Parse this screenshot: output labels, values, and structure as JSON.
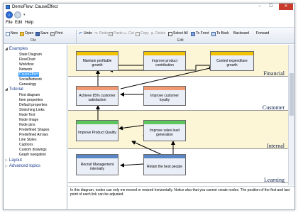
{
  "window": {
    "title": "DemoFlow: CauseEffect",
    "controls": {
      "minimize": "–",
      "maximize": "☐",
      "close": "✕"
    }
  },
  "menu": {
    "file": "File",
    "edit": "Edit",
    "help": "Help"
  },
  "toolbar": {
    "new": "New",
    "open": "Open",
    "save": "Save",
    "print": "Print",
    "undo": "Undo",
    "redo": "Redo",
    "copy_format": "Paste",
    "cut": "Cut",
    "copy": "Copy",
    "delete": "Delete",
    "select_all": "Select All",
    "to_front": "To Front",
    "to_back": "To Back",
    "backward": "Backward",
    "forward": "Forward",
    "group_file": "File",
    "group_edit": "Edit"
  },
  "sidebar": {
    "examples": "Examples",
    "example_items": [
      "State Diagram",
      "FlowChart",
      "Workflow",
      "Network",
      "CauseEffect",
      "SocialNetwork",
      "Genealogy"
    ],
    "tutorial": "Tutorial",
    "tutorial_items": [
      "First diagram",
      "Item properties",
      "Default properties",
      "Stretching Links",
      "Node Text",
      "Node Image",
      "Node pins",
      "Predefined Shapes",
      "Predefined Arrows",
      "Line Styles",
      "Captions",
      "Custom drawings",
      "Graph navigation"
    ],
    "layout": "Layout",
    "advanced": "Advanced topics"
  },
  "diagram": {
    "bands": [
      "Financial",
      "Customer",
      "Internal",
      "Learning"
    ],
    "nodes": {
      "maintain": "Maintain profitable growth",
      "improve_product": "Improve product contribution",
      "control_expenditure": "Control expenditure growth",
      "satisfaction": "Achieve 85% customer satisfaction",
      "loyalty": "Improve customer loyalty",
      "quality": "Improve Product Quality",
      "sales_lead": "Improve sales lead generation",
      "recruit": "Recruit Management internally",
      "retain": "Retain the best people"
    },
    "colors": {
      "yellow": "#f2c200",
      "orange": "#f09a73",
      "green": "#5cc65c",
      "blue": "#5a86c5"
    }
  },
  "status": {
    "text": "In this diagram, nodes can only me moved or resized horizontally. Notice also that you cannot create nodes. The position of the first and last point of each link can be adjusted."
  }
}
